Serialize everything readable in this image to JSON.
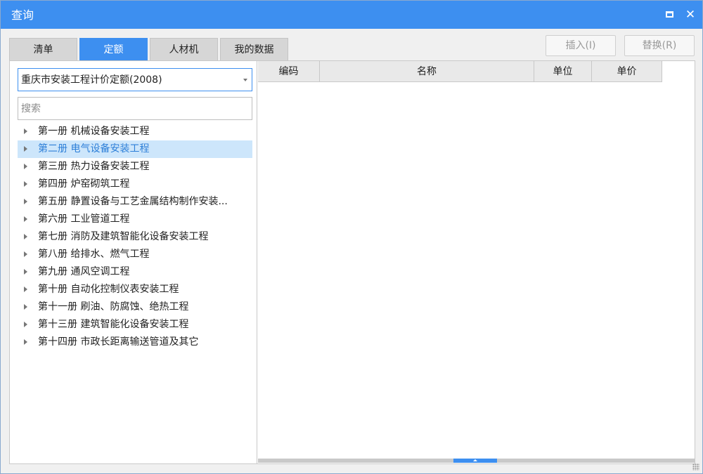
{
  "window": {
    "title": "查询"
  },
  "tabs": [
    {
      "label": "清单",
      "active": false
    },
    {
      "label": "定额",
      "active": true
    },
    {
      "label": "人材机",
      "active": false
    },
    {
      "label": "我的数据",
      "active": false
    }
  ],
  "actions": {
    "insert_label": "插入(I)",
    "replace_label": "替换(R)"
  },
  "library_select": {
    "value": "重庆市安装工程计价定额(2008)"
  },
  "search": {
    "placeholder": "搜索",
    "value": ""
  },
  "tree": {
    "items": [
      {
        "label": "第一册 机械设备安装工程",
        "selected": false
      },
      {
        "label": "第二册 电气设备安装工程",
        "selected": true
      },
      {
        "label": "第三册 热力设备安装工程",
        "selected": false
      },
      {
        "label": "第四册 炉窑砌筑工程",
        "selected": false
      },
      {
        "label": "第五册 静置设备与工艺金属结构制作安装...",
        "selected": false
      },
      {
        "label": "第六册 工业管道工程",
        "selected": false
      },
      {
        "label": "第七册 消防及建筑智能化设备安装工程",
        "selected": false
      },
      {
        "label": "第八册 给排水、燃气工程",
        "selected": false
      },
      {
        "label": "第九册 通风空调工程",
        "selected": false
      },
      {
        "label": "第十册 自动化控制仪表安装工程",
        "selected": false
      },
      {
        "label": "第十一册 刷油、防腐蚀、绝热工程",
        "selected": false
      },
      {
        "label": "第十三册 建筑智能化设备安装工程",
        "selected": false
      },
      {
        "label": "第十四册 市政长距离输送管道及其它",
        "selected": false
      }
    ]
  },
  "grid": {
    "columns": [
      "编码",
      "名称",
      "单位",
      "单价"
    ],
    "rows": []
  },
  "colors": {
    "accent": "#3d8ff0",
    "selected_bg": "#cde6fb",
    "selected_text": "#2d7fd8"
  }
}
